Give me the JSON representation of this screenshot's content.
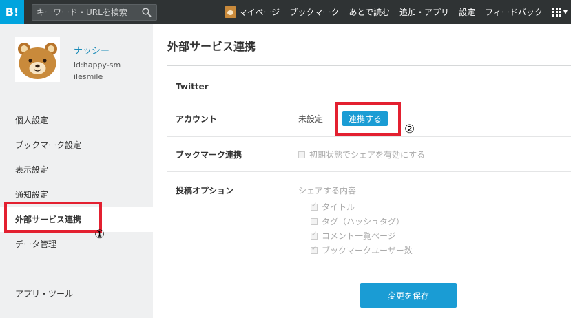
{
  "topbar": {
    "logo": "B!",
    "search_placeholder": "キーワード・URLを検索",
    "nav": [
      "マイページ",
      "ブックマーク",
      "あとで読む",
      "追加・アプリ",
      "設定",
      "フィードバック"
    ]
  },
  "profile": {
    "name": "ナッシー",
    "id": "id:happy-smilesmile"
  },
  "sidebar": {
    "items": [
      "個人設定",
      "ブックマーク設定",
      "表示設定",
      "通知設定",
      "外部サービス連携",
      "データ管理"
    ],
    "footer": "アプリ・ツール"
  },
  "main": {
    "title": "外部サービス連携",
    "section": "Twitter",
    "account": {
      "label": "アカウント",
      "status": "未設定",
      "button": "連携する"
    },
    "bookmark": {
      "label": "ブックマーク連携",
      "option": "初期状態でシェアを有効にする",
      "checked": false
    },
    "post": {
      "label": "投稿オプション",
      "caption": "シェアする内容",
      "options": [
        {
          "label": "タイトル",
          "checked": true
        },
        {
          "label": "タグ（ハッシュタグ）",
          "checked": false
        },
        {
          "label": "コメント一覧ページ",
          "checked": true
        },
        {
          "label": "ブックマークユーザー数",
          "checked": true
        }
      ]
    },
    "save_button": "変更を保存"
  },
  "annotations": {
    "first": "①",
    "second": "②"
  },
  "colors": {
    "accent": "#1a9cd4",
    "topbar": "#2f3334",
    "highlight": "#e32030",
    "sidebar": "#eff0f1"
  }
}
